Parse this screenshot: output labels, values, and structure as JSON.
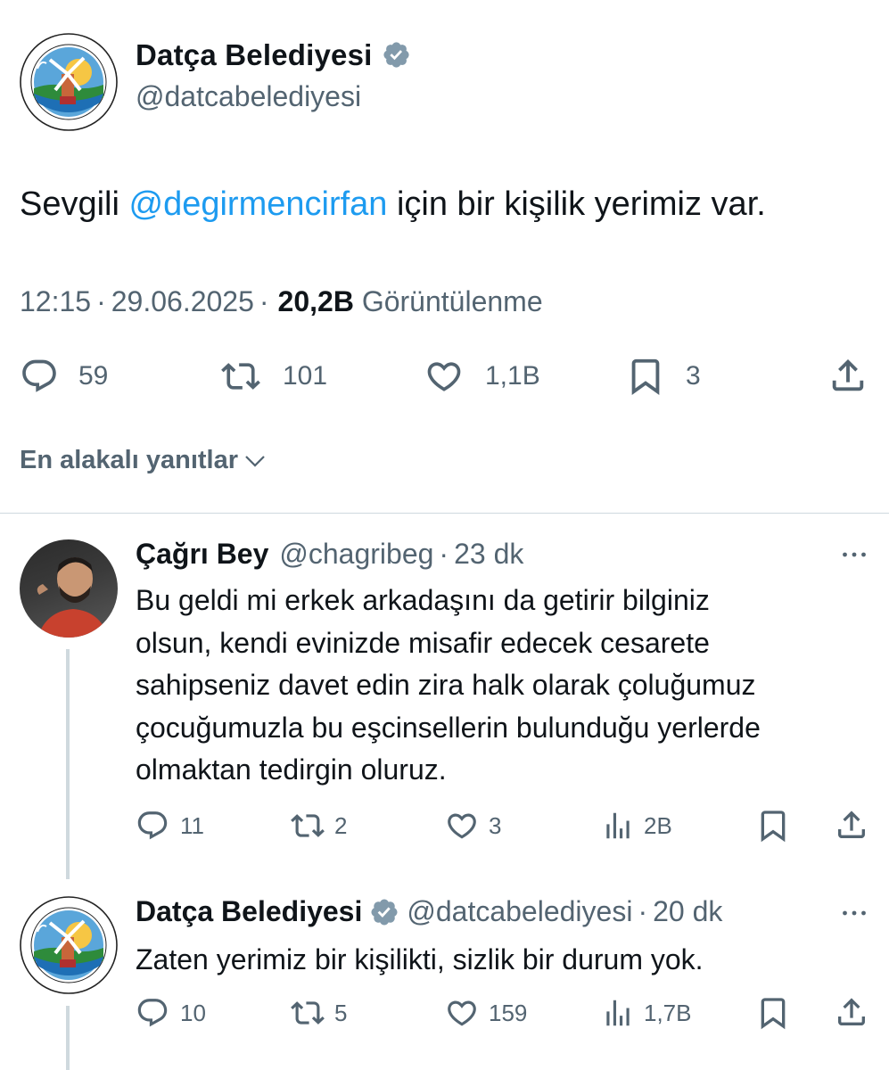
{
  "main_tweet": {
    "author_name": "Datça Belediyesi",
    "author_handle": "@datcabelediyesi",
    "logo_text": {
      "top": "DATÇA BELEDİYESİ",
      "bottom": "MUNICIPALITY OF DATÇA·TÜRKİYE",
      "year": "1920"
    },
    "text_before": "Sevgili ",
    "mention": "@degirmencirfan",
    "text_after": " için bir kişilik yerimiz var.",
    "time": "12:15",
    "date": "29.06.2025",
    "views_count": "20,2B",
    "views_label": "Görüntülenme",
    "separator": "·",
    "actions": {
      "replies": "59",
      "reposts": "101",
      "likes": "1,1B",
      "bookmarks": "3"
    }
  },
  "replies_section": {
    "label": "En alakalı yanıtlar"
  },
  "replies": [
    {
      "author_name": "Çağrı Bey",
      "author_handle": "@chagribeg",
      "time": "23 dk",
      "separator": "·",
      "lines": [
        "Bu geldi mi erkek arkadaşını da getirir bilginiz",
        "olsun, kendi evinizde misafir edecek cesarete",
        "sahipseniz davet edin zira halk olarak çoluğumuz",
        "çocuğumuzla bu eşcinsellerin bulunduğu yerlerde",
        "olmaktan tedirgin oluruz."
      ],
      "actions": {
        "replies": "11",
        "reposts": "2",
        "likes": "3",
        "views": "2B"
      }
    },
    {
      "author_name": "Datça Belediyesi",
      "author_handle": "@datcabelediyesi",
      "time": "20 dk",
      "separator": "·",
      "lines": [
        "Zaten yerimiz bir kişilikti, sizlik bir durum yok."
      ],
      "actions": {
        "replies": "10",
        "reposts": "5",
        "likes": "159",
        "views": "1,7B"
      }
    }
  ],
  "colors": {
    "text": "#0f1419",
    "muted": "#536471",
    "link": "#1d9bf0",
    "verified": "#829aab",
    "divider": "#cfd9de"
  },
  "icons": [
    "verified-badge-icon",
    "reply-icon",
    "repost-icon",
    "like-icon",
    "bookmark-icon",
    "share-icon",
    "views-icon",
    "more-icon",
    "chevron-down-icon"
  ]
}
